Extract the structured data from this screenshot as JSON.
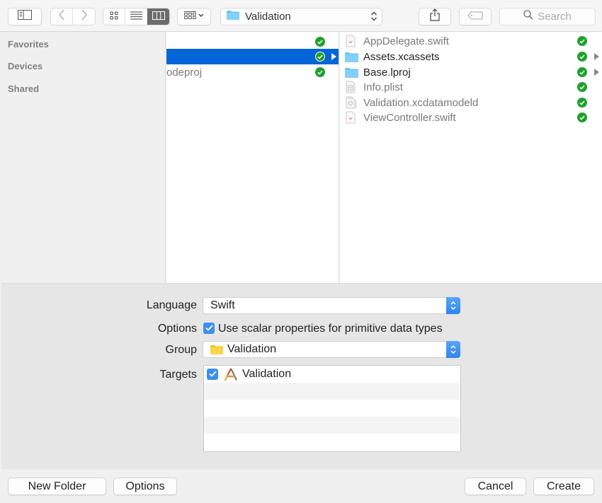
{
  "toolbar": {
    "sidebar_toggle_icon": "sidebar-icon",
    "back_icon": "chevron-left-icon",
    "forward_icon": "chevron-right-icon",
    "view_modes": [
      {
        "name": "icon-view",
        "icon": "grid-icon",
        "active": false
      },
      {
        "name": "list-view",
        "icon": "list-icon",
        "active": false
      },
      {
        "name": "column-view",
        "icon": "columns-icon",
        "active": true
      }
    ],
    "arrange_icon": "arrange-icon",
    "location": "Validation",
    "share_icon": "share-icon",
    "tag_icon": "tag-icon",
    "search_placeholder": "Search"
  },
  "sidebar": {
    "sections": [
      "Favorites",
      "Devices",
      "Shared"
    ]
  },
  "column1": {
    "rows": [
      {
        "label": "",
        "status": "ok",
        "selected": false,
        "has_children": false
      },
      {
        "label": "",
        "status": "ok",
        "selected": true,
        "has_children": true
      },
      {
        "label": "odeproj",
        "status": "ok",
        "selected": false,
        "has_children": false
      }
    ]
  },
  "column2": {
    "rows": [
      {
        "label": "AppDelegate.swift",
        "icon": "swift-file-icon",
        "enabled": false,
        "status": "ok",
        "has_children": false
      },
      {
        "label": "Assets.xcassets",
        "icon": "folder-icon",
        "enabled": true,
        "status": "ok",
        "has_children": true
      },
      {
        "label": "Base.lproj",
        "icon": "folder-icon",
        "enabled": true,
        "status": "ok",
        "has_children": true
      },
      {
        "label": "Info.plist",
        "icon": "plist-file-icon",
        "enabled": false,
        "status": "ok",
        "has_children": false
      },
      {
        "label": "Validation.xcdatamodeld",
        "icon": "datamodel-file-icon",
        "enabled": false,
        "status": "ok",
        "has_children": false
      },
      {
        "label": "ViewController.swift",
        "icon": "swift-file-icon",
        "enabled": false,
        "status": "ok",
        "has_children": false
      }
    ]
  },
  "options": {
    "language_label": "Language",
    "language_value": "Swift",
    "options_label": "Options",
    "scalar_checkbox_label": "Use scalar properties for primitive data types",
    "scalar_checked": true,
    "group_label": "Group",
    "group_value": "Validation",
    "targets_label": "Targets",
    "targets": [
      {
        "label": "Validation",
        "checked": true,
        "icon": "app-target-icon"
      }
    ]
  },
  "buttons": {
    "new_folder": "New Folder",
    "options": "Options",
    "cancel": "Cancel",
    "create": "Create"
  },
  "colors": {
    "selection": "#0465d6",
    "status_ok": "#1fa12b",
    "accent": "#3d8ff0"
  }
}
